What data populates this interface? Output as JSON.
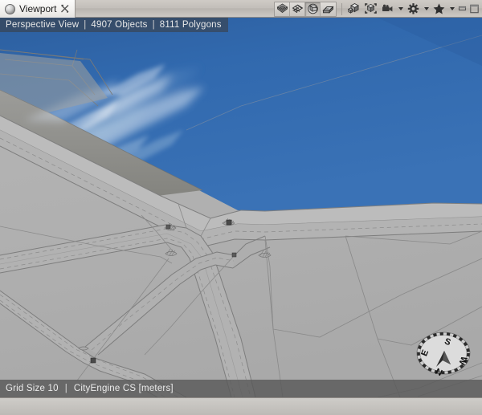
{
  "window": {
    "tab": {
      "label": "Viewport",
      "icon": "sphere-icon",
      "close_icon": "close-icon",
      "active": true
    },
    "controls": [
      {
        "name": "minimize-button",
        "icon": "minimize-icon"
      },
      {
        "name": "maximize-button",
        "icon": "maximize-icon"
      }
    ]
  },
  "toolbar": {
    "shading_group": [
      {
        "name": "shading-wireframe-button",
        "icon": "shaded-faceted-icon",
        "pressed": false
      },
      {
        "name": "shading-wireframe-overlay-button",
        "icon": "wireframe-icon",
        "pressed": false
      },
      {
        "name": "shading-textured-button",
        "icon": "shaded-solid-icon",
        "pressed": false
      },
      {
        "name": "shading-solid-button",
        "icon": "shaded-textured-icon",
        "pressed": false
      }
    ],
    "items": [
      {
        "name": "object-display-button",
        "icon": "boxes-icon",
        "has_dropdown": false
      },
      {
        "name": "bounding-box-button",
        "icon": "bounding-box-icon",
        "has_dropdown": false
      },
      {
        "name": "camera-button",
        "icon": "camera-icon",
        "has_dropdown": true
      },
      {
        "name": "settings-button",
        "icon": "gear-icon",
        "has_dropdown": true
      },
      {
        "name": "bookmarks-button",
        "icon": "star-icon",
        "has_dropdown": true
      }
    ]
  },
  "viewport": {
    "info": {
      "view_mode": "Perspective View",
      "objects": "4907 Objects",
      "polygons": "8111 Polygons",
      "separator": "|"
    },
    "status": {
      "grid": "Grid Size 10",
      "coordinate_system": "CityEngine CS [meters]",
      "separator": "|"
    },
    "compass": {
      "north": "N",
      "east": "E",
      "south": "S",
      "west": "W"
    },
    "colors": {
      "water": "#3169ae",
      "ground": "#b0b0b0",
      "terrain_shadow": "#8d8d8a",
      "street_line": "#7d7d7d",
      "node": "#4a4a4a",
      "sky": "#b0b0b0"
    },
    "scene_description": "3D perspective view of a city street network beside a river"
  }
}
